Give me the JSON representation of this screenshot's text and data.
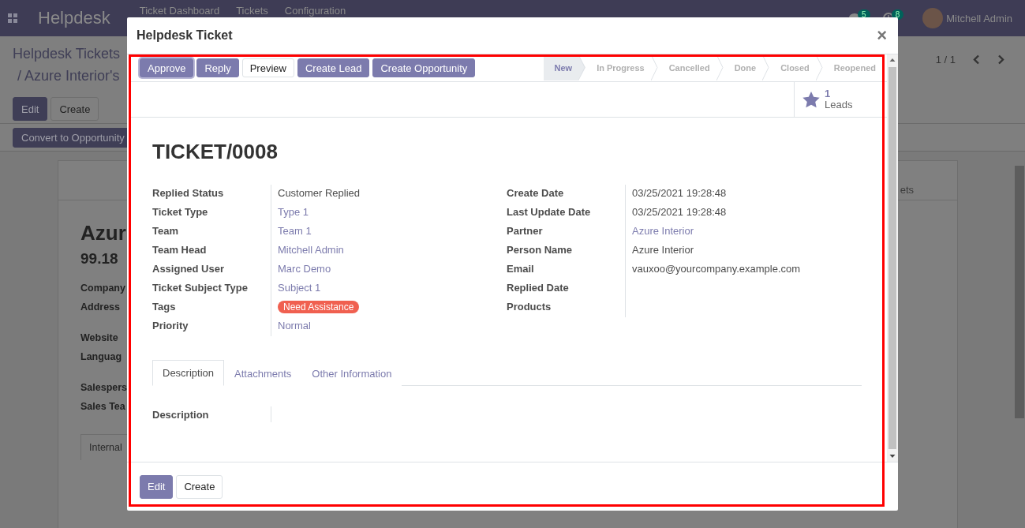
{
  "navbar": {
    "app": "Helpdesk",
    "menu": [
      "Ticket Dashboard",
      "Tickets",
      "Configuration"
    ],
    "messages_badge": "5",
    "activities_badge": "8",
    "user": "Mitchell Admin"
  },
  "background": {
    "breadcrumb": [
      "Helpdesk Tickets",
      "/ Azure Interior's"
    ],
    "buttons": [
      {
        "label": "Edit",
        "kind": "primary"
      },
      {
        "label": "Create",
        "kind": "secondary"
      }
    ],
    "action": "Convert to Opportunity",
    "pager": "1 / 1",
    "sheet": {
      "stat_label": "ets",
      "title": "Azur",
      "subtitle": "99.18",
      "field_groups": [
        [
          "Company",
          "Address"
        ],
        [
          "Website",
          "Languag"
        ],
        [
          "Salespers",
          "Sales Tea"
        ]
      ],
      "tab": "Internal"
    }
  },
  "dialog": {
    "title": "Helpdesk Ticket",
    "close": "×",
    "actions": [
      {
        "label": "Approve",
        "kind": "primary",
        "focused": true
      },
      {
        "label": "Reply",
        "kind": "primary",
        "focused": false
      },
      {
        "label": "Preview",
        "kind": "secondary",
        "focused": false
      },
      {
        "label": "Create Lead",
        "kind": "primary",
        "focused": false
      },
      {
        "label": "Create Opportunity",
        "kind": "primary",
        "focused": false
      }
    ],
    "stages": [
      {
        "label": "New",
        "selected": true
      },
      {
        "label": "In Progress",
        "selected": false
      },
      {
        "label": "Cancelled",
        "selected": false
      },
      {
        "label": "Done",
        "selected": false
      },
      {
        "label": "Closed",
        "selected": false
      },
      {
        "label": "Reopened",
        "selected": false
      }
    ],
    "stat": {
      "count": "1",
      "label": "Leads"
    },
    "name": "TICKET/0008",
    "left_fields": [
      {
        "label": "Replied Status",
        "value": "Customer Replied",
        "kind": "text"
      },
      {
        "label": "Ticket Type",
        "value": "Type 1",
        "kind": "link"
      },
      {
        "label": "Team",
        "value": "Team 1",
        "kind": "link"
      },
      {
        "label": "Team Head",
        "value": "Mitchell Admin",
        "kind": "link"
      },
      {
        "label": "Assigned User",
        "value": "Marc Demo",
        "kind": "link"
      },
      {
        "label": "Ticket Subject Type",
        "value": "Subject 1",
        "kind": "link"
      },
      {
        "label": "Tags",
        "value": "Need Assistance",
        "kind": "tag"
      },
      {
        "label": "Priority",
        "value": "Normal",
        "kind": "link"
      }
    ],
    "right_fields": [
      {
        "label": "Create Date",
        "value": "03/25/2021 19:28:48",
        "kind": "text"
      },
      {
        "label": "Last Update Date",
        "value": "03/25/2021 19:28:48",
        "kind": "text"
      },
      {
        "label": "Partner",
        "value": "Azure Interior",
        "kind": "link"
      },
      {
        "label": "Person Name",
        "value": "Azure Interior",
        "kind": "text"
      },
      {
        "label": "Email",
        "value": "vauxoo@yourcompany.example.com",
        "kind": "text"
      },
      {
        "label": "Replied Date",
        "kind": "empty"
      },
      {
        "label": "Products",
        "kind": "empty"
      }
    ],
    "tabs": [
      {
        "label": "Description",
        "selected": true
      },
      {
        "label": "Attachments",
        "selected": false
      },
      {
        "label": "Other Information",
        "selected": false
      }
    ],
    "description_label": "Description",
    "footer_buttons": [
      {
        "label": "Edit",
        "kind": "primary"
      },
      {
        "label": "Create",
        "kind": "secondary"
      }
    ]
  }
}
